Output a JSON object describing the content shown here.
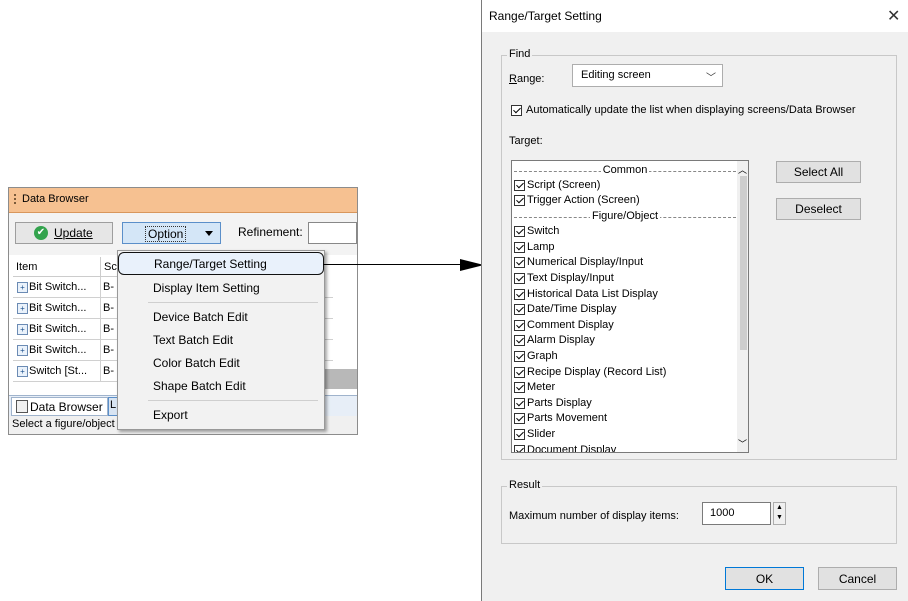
{
  "data_browser": {
    "title": "Data Browser",
    "update_label": "Update",
    "option_label": "Option",
    "refinement_label": "Refinement:",
    "columns": [
      "Item",
      "Sc"
    ],
    "rows": [
      {
        "item": "Bit Switch...",
        "sc": "B-"
      },
      {
        "item": "Bit Switch...",
        "sc": "B-"
      },
      {
        "item": "Bit Switch...",
        "sc": "B-"
      },
      {
        "item": "Bit Switch...",
        "sc": "B-"
      },
      {
        "item": "Switch [St...",
        "sc": "B-"
      }
    ],
    "tab_label": "Data Browser",
    "tab2_label": "L",
    "status": "Select a figure/object"
  },
  "context_menu": {
    "items": [
      "Range/Target Setting",
      "Display Item Setting",
      "Device Batch Edit",
      "Text Batch Edit",
      "Color Batch Edit",
      "Shape Batch Edit",
      "Export"
    ]
  },
  "dialog": {
    "title": "Range/Target Setting",
    "close_glyph": "✕",
    "find_group": "Find",
    "range_label": "Range:",
    "range_value": "Editing screen",
    "auto_update_label": "Automatically update the list when displaying screens/Data Browser",
    "target_label": "Target:",
    "target_items": [
      {
        "type": "header",
        "label": "Common"
      },
      {
        "type": "item",
        "label": "Script (Screen)"
      },
      {
        "type": "item",
        "label": "Trigger Action (Screen)"
      },
      {
        "type": "header",
        "label": "Figure/Object"
      },
      {
        "type": "item",
        "label": "Switch"
      },
      {
        "type": "item",
        "label": "Lamp"
      },
      {
        "type": "item",
        "label": "Numerical Display/Input"
      },
      {
        "type": "item",
        "label": "Text Display/Input"
      },
      {
        "type": "item",
        "label": "Historical Data List Display"
      },
      {
        "type": "item",
        "label": "Date/Time Display"
      },
      {
        "type": "item",
        "label": "Comment Display"
      },
      {
        "type": "item",
        "label": "Alarm Display"
      },
      {
        "type": "item",
        "label": "Graph"
      },
      {
        "type": "item",
        "label": "Recipe Display (Record List)"
      },
      {
        "type": "item",
        "label": "Meter"
      },
      {
        "type": "item",
        "label": "Parts Display"
      },
      {
        "type": "item",
        "label": "Parts Movement"
      },
      {
        "type": "item",
        "label": "Slider"
      },
      {
        "type": "item",
        "label": "Document Display"
      }
    ],
    "select_all_label": "Select All",
    "deselect_label": "Deselect",
    "result_group": "Result",
    "max_items_label": "Maximum number of display items:",
    "max_items_value": "1000",
    "ok_label": "OK",
    "cancel_label": "Cancel"
  }
}
